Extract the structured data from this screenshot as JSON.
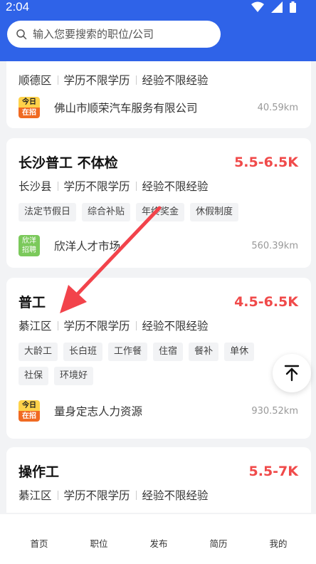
{
  "status_bar": {
    "time": "2:04"
  },
  "search": {
    "placeholder": "输入您要搜索的职位/公司"
  },
  "jobs": [
    {
      "title": "",
      "salary": "",
      "district": "顺德区",
      "education": "学历不限学历",
      "experience": "经验不限经验",
      "tags": [],
      "company": "佛山市顺荣汽车服务有限公司",
      "company_logo": "jinri-zaizhao",
      "distance": "40.59km"
    },
    {
      "title": "长沙普工 不体检",
      "salary": "5.5-6.5K",
      "district": "长沙县",
      "education": "学历不限学历",
      "experience": "经验不限经验",
      "tags": [
        "法定节假日",
        "综合补贴",
        "年终奖金",
        "休假制度"
      ],
      "company": "欣洋人才市场",
      "company_logo": "xinyang-zhaopin",
      "distance": "560.39km"
    },
    {
      "title": "普工",
      "salary": "4.5-6.5K",
      "district": "綦江区",
      "education": "学历不限学历",
      "experience": "经验不限经验",
      "tags": [
        "大龄工",
        "长白班",
        "工作餐",
        "住宿",
        "餐补",
        "单休",
        "社保",
        "环境好"
      ],
      "company": "量身定志人力资源",
      "company_logo": "jinri-zaizhao",
      "distance": "930.52km"
    },
    {
      "title": "操作工",
      "salary": "5.5-7K",
      "district": "綦江区",
      "education": "学历不限学历",
      "experience": "经验不限经验",
      "tags": [],
      "company": "",
      "company_logo": "",
      "distance": ""
    }
  ],
  "logos": {
    "jinri_top": "今日",
    "jinri_bottom": "在招",
    "xinyang_top": "欣洋",
    "xinyang_bottom": "招聘"
  },
  "tabbar": [
    "首页",
    "职位",
    "发布",
    "简历",
    "我的"
  ],
  "colors": {
    "brand": "#2f63e8",
    "salary": "#f04a4a",
    "annotation_arrow": "#f2434b"
  }
}
